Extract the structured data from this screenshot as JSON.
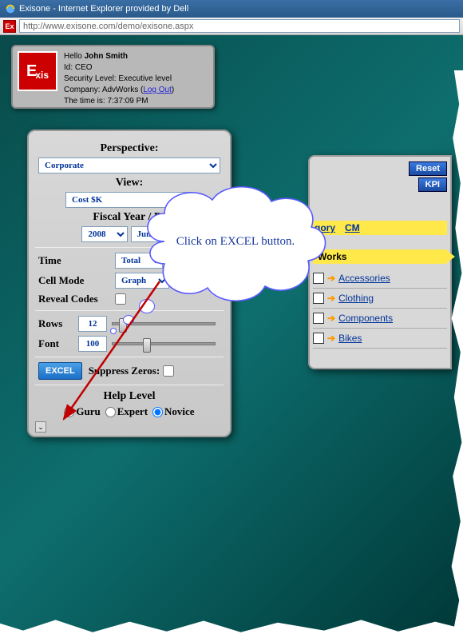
{
  "window": {
    "title": "Exisone - Internet Explorer provided by Dell",
    "url": "http://www.exisone.com/demo/exisone.aspx"
  },
  "user": {
    "greeting": "Hello",
    "name": "John Smith",
    "id_label": "Id:",
    "id_value": "CEO",
    "security_label": "Security Level:",
    "security_value": "Executive level",
    "company_label": "Company:",
    "company_value": "AdvWorks",
    "logout_label": "Log Out",
    "time_label": "The time is:",
    "time_value": "7:37:09 PM"
  },
  "logo_text": "Exis",
  "panel": {
    "perspective_label": "Perspective:",
    "perspective_value": "Corporate",
    "view_label": "View:",
    "view_value": "Cost $K",
    "fiscal_label": "Fiscal Year / Pe",
    "fiscal_year": "2008",
    "fiscal_month": "June",
    "time_label": "Time",
    "time_value": "Total",
    "cellmode_label": "Cell Mode",
    "cellmode_value": "Graph",
    "reveal_label": "Reveal Codes",
    "rows_label": "Rows",
    "rows_value": "12",
    "font_label": "Font",
    "font_value": "100",
    "excel_label": "EXCEL",
    "suppress_label": "Suppress Zeros:",
    "help_label": "Help Level",
    "help_options": [
      "Guru",
      "Expert",
      "Novice"
    ],
    "help_selected": "Novice"
  },
  "right": {
    "reset_label": "Reset",
    "kpi_label": "KPI",
    "category_head": "gory",
    "cm_label": "CM",
    "works_label": "Works",
    "items": [
      "Accessories",
      "Clothing",
      "Components",
      "Bikes"
    ]
  },
  "callout": {
    "text": "Click on EXCEL button."
  }
}
